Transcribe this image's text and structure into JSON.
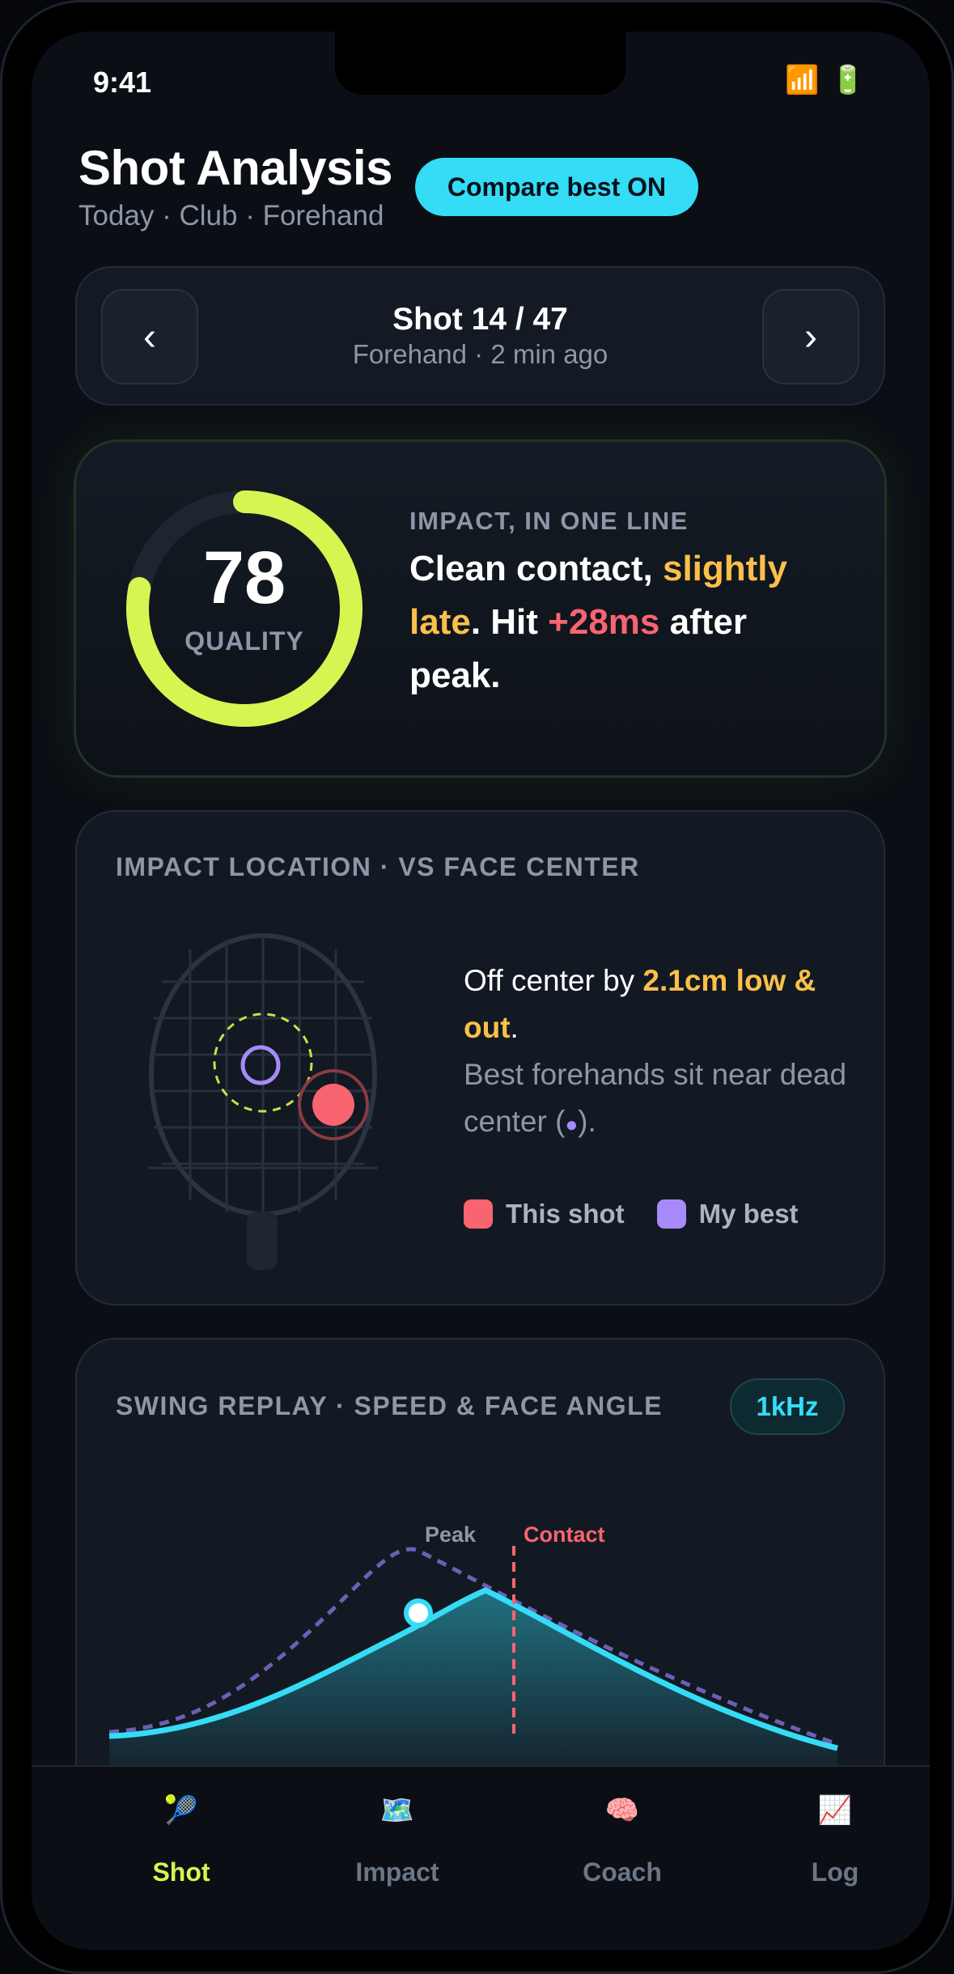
{
  "status_bar": {
    "time": "9:41",
    "wifi_icon": "wifi-icon",
    "battery_icon": "battery-icon"
  },
  "header": {
    "title": "Shot Analysis",
    "subtitle": "Today · Club · Forehand",
    "compare_button": "Compare best ON"
  },
  "shot_nav": {
    "prev": "‹",
    "next": "›",
    "title": "Shot 14 / 47",
    "subtitle": "Forehand · 2 min ago"
  },
  "quality": {
    "score": "78",
    "score_fraction": 0.78,
    "label": "QUALITY",
    "heading": "IMPACT, IN ONE LINE",
    "line_part1": "Clean contact, ",
    "line_highlight1": "slightly late",
    "line_part2": ". Hit ",
    "line_highlight2": "+28ms",
    "line_part3": " after peak."
  },
  "impact_location": {
    "heading": "IMPACT LOCATION · VS FACE CENTER",
    "text_part1": "Off center by ",
    "text_highlight": "2.1cm low & out",
    "text_part2": ".",
    "note_part1": "Best forehands sit near dead center (",
    "note_dot": "●",
    "note_part2": ").",
    "legend": [
      {
        "label": "This shot",
        "color": "#f8646f"
      },
      {
        "label": "My best",
        "color": "#a78bfa"
      }
    ]
  },
  "swing_replay": {
    "heading": "SWING REPLAY · SPEED & FACE ANGLE",
    "badge": "1kHz",
    "peak_label": "Peak",
    "contact_label": "Contact"
  },
  "tabs": [
    {
      "label": "Shot",
      "icon": "🎾",
      "active": true
    },
    {
      "label": "Impact",
      "icon": "🗺️",
      "active": false
    },
    {
      "label": "Coach",
      "icon": "🧠",
      "active": false
    },
    {
      "label": "Log",
      "icon": "📈",
      "active": false
    }
  ],
  "colors": {
    "accent_cyan": "#35dcf6",
    "accent_lime": "#d6f550",
    "amber": "#fbbf4a",
    "red": "#f8646f",
    "purple": "#a78bfa"
  }
}
